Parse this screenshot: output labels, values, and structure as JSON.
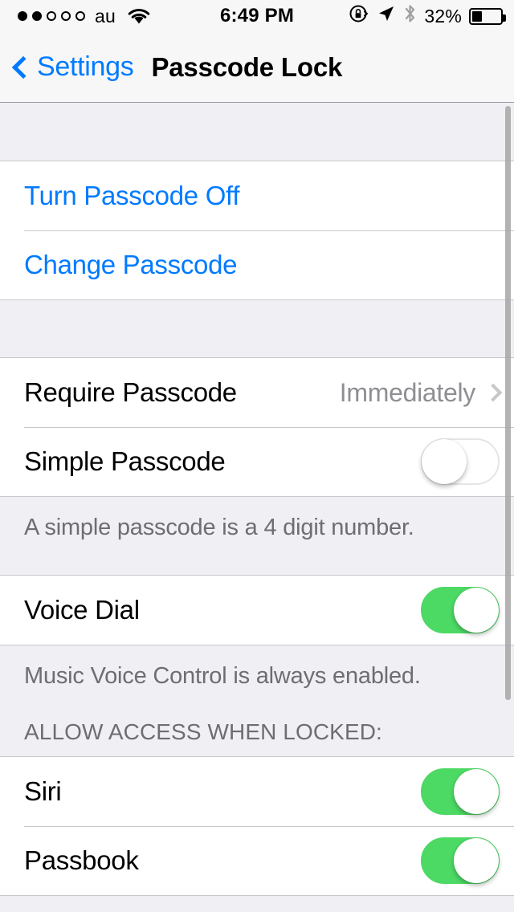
{
  "status_bar": {
    "signal_dots_filled": 2,
    "signal_dots_total": 5,
    "carrier": "au",
    "wifi_icon": "wifi-icon",
    "time": "6:49 PM",
    "rotation_lock_icon": "rotation-lock-icon",
    "location_icon": "location-arrow-icon",
    "bluetooth_icon": "bluetooth-icon",
    "battery_percent": "32%",
    "battery_level": 32
  },
  "nav_bar": {
    "back_icon": "chevron-left-icon",
    "back_label": "Settings",
    "title": "Passcode Lock"
  },
  "groups": {
    "passcode_actions": [
      {
        "label": "Turn Passcode Off"
      },
      {
        "label": "Change Passcode"
      }
    ],
    "passcode_options": {
      "require": {
        "label": "Require Passcode",
        "value": "Immediately",
        "chevron_icon": "chevron-right-icon"
      },
      "simple": {
        "label": "Simple Passcode",
        "state": "off"
      },
      "footer": "A simple passcode is a 4 digit number."
    },
    "voice": {
      "voice_dial": {
        "label": "Voice Dial",
        "state": "on"
      },
      "footer": "Music Voice Control is always enabled."
    },
    "allow_access": {
      "header": "ALLOW ACCESS WHEN LOCKED:",
      "items": [
        {
          "label": "Siri",
          "state": "on"
        },
        {
          "label": "Passbook",
          "state": "on"
        }
      ]
    }
  },
  "colors": {
    "tint_blue": "#007aff",
    "toggle_green": "#4cd964",
    "value_gray": "#8e8e93",
    "group_bg": "#efeff4",
    "separator": "#c8c7cc"
  }
}
